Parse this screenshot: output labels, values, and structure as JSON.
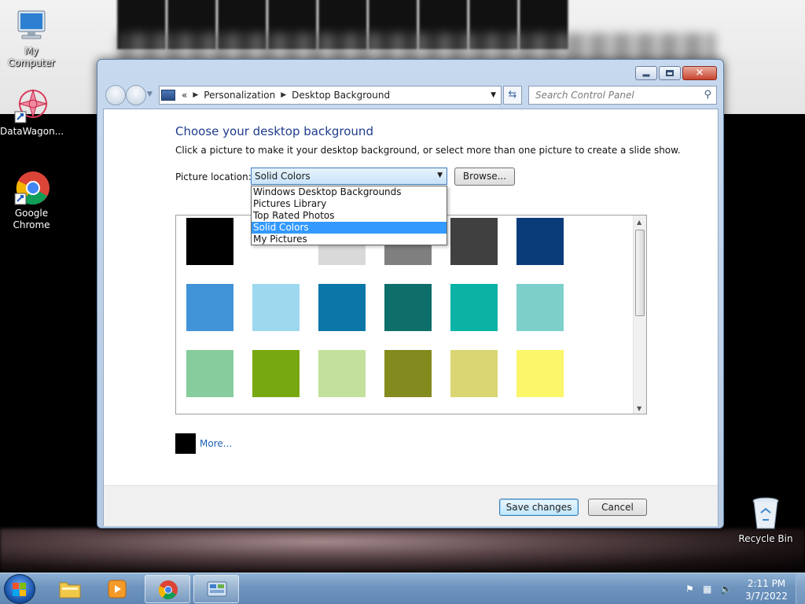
{
  "desktop": {
    "icons": [
      {
        "label": "My Computer"
      },
      {
        "label": "DataWagon..."
      },
      {
        "label": "Google Chrome"
      },
      {
        "label": "Recycle Bin"
      }
    ]
  },
  "window": {
    "breadcrumb": {
      "overflow": "«",
      "items": [
        "Personalization",
        "Desktop Background"
      ]
    },
    "search_placeholder": "Search Control Panel",
    "heading": "Choose your desktop background",
    "description": "Click a picture to make it your desktop background, or select more than one picture to create a slide show.",
    "picture_location_label": "Picture location:",
    "picture_location_value": "Solid Colors",
    "browse_label": "Browse...",
    "location_options": [
      {
        "label": "Windows Desktop Backgrounds",
        "selected": false
      },
      {
        "label": "Pictures Library",
        "selected": false
      },
      {
        "label": "Top Rated Photos",
        "selected": false
      },
      {
        "label": "Solid Colors",
        "selected": true
      },
      {
        "label": "My Pictures",
        "selected": false
      }
    ],
    "swatches": [
      {
        "color": "#000000"
      },
      {
        "color": "#ffffff"
      },
      {
        "color": "#d9d9d9"
      },
      {
        "color": "#7f7f7f"
      },
      {
        "color": "#404040"
      },
      {
        "color": "#0b3c7a"
      },
      {
        "color": "#4193d8"
      },
      {
        "color": "#9ed8ee"
      },
      {
        "color": "#0b76a8"
      },
      {
        "color": "#0e6e6a"
      },
      {
        "color": "#0ab3a4"
      },
      {
        "color": "#7dcfca"
      },
      {
        "color": "#86cc9c"
      },
      {
        "color": "#78a80f"
      },
      {
        "color": "#c3e09c"
      },
      {
        "color": "#838a1e"
      },
      {
        "color": "#d9d673"
      },
      {
        "color": "#fbf66a"
      }
    ],
    "more_color": "#000000",
    "more_label": "More...",
    "save_label": "Save changes",
    "cancel_label": "Cancel"
  },
  "taskbar": {
    "clock_time": "2:11 PM",
    "clock_date": "3/7/2022"
  }
}
